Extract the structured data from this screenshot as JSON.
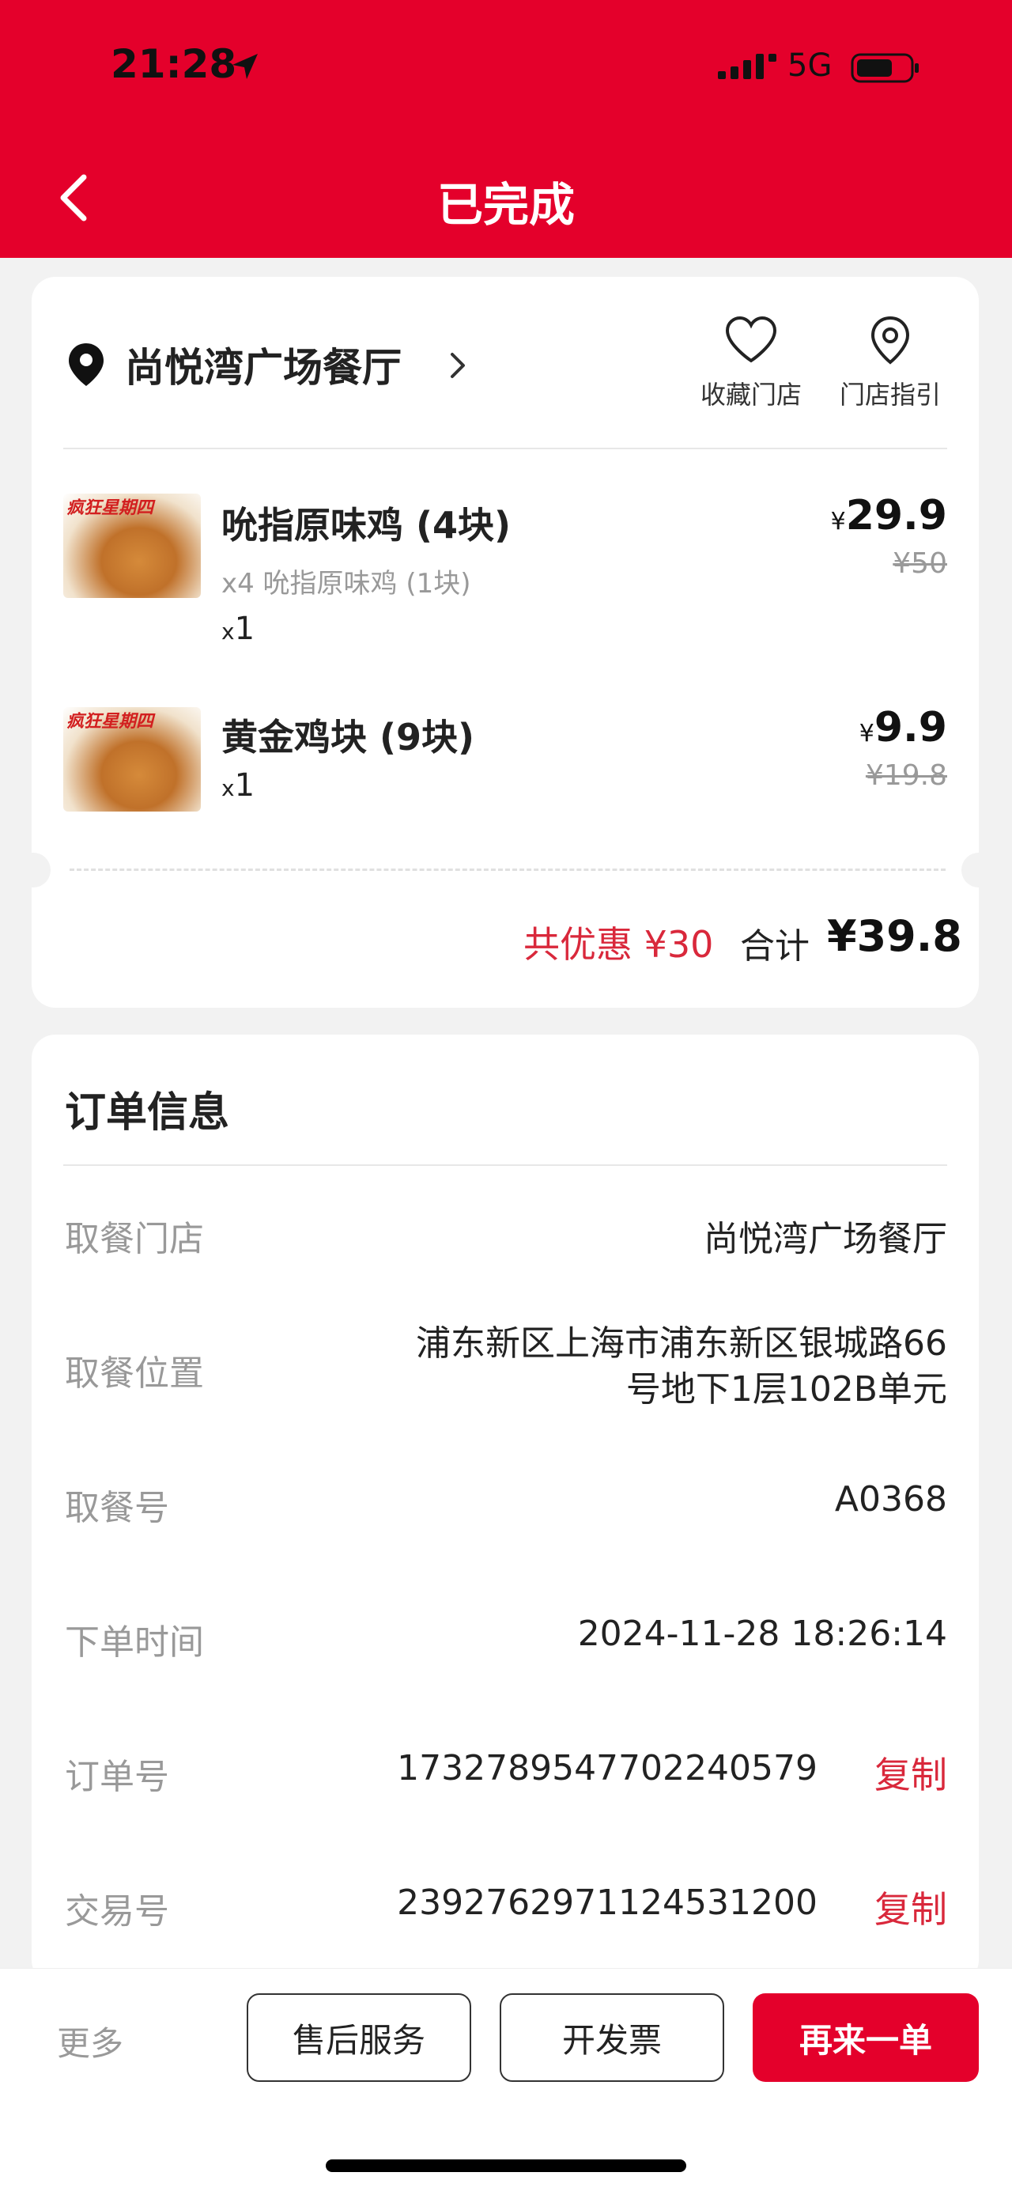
{
  "status_bar": {
    "time": "21:28",
    "network": "5G",
    "icons": [
      "location-arrow-icon",
      "signal-icon",
      "battery-icon"
    ]
  },
  "header": {
    "title": "已完成",
    "back_icon": "chevron-left-icon",
    "color": "#e4002b"
  },
  "store": {
    "name": "尚悦湾广场餐厅",
    "favorite_label": "收藏门店",
    "guide_label": "门店指引"
  },
  "items": [
    {
      "banner": "疯狂星期四",
      "name": "吮指原味鸡 (4块)",
      "sub": "x4 吮指原味鸡 (1块)",
      "qty_prefix": "x",
      "qty": "1",
      "currency": "¥",
      "price": "29.9",
      "original_price": "¥50"
    },
    {
      "banner": "疯狂星期四",
      "name": "黄金鸡块 (9块)",
      "sub": "",
      "qty_prefix": "x",
      "qty": "1",
      "currency": "¥",
      "price": "9.9",
      "original_price": "¥19.8"
    }
  ],
  "summary": {
    "discount": "共优惠 ¥30",
    "total_label": "合计",
    "total": "¥39.8"
  },
  "order_info": {
    "title": "订单信息",
    "copy_label": "复制",
    "rows": [
      {
        "label": "取餐门店",
        "value": "尚悦湾广场餐厅"
      },
      {
        "label": "取餐位置",
        "value_line1": "浦东新区上海市浦东新区银城路66",
        "value_line2": "号地下1层102B单元"
      },
      {
        "label": "取餐号",
        "value": "A0368"
      },
      {
        "label": "下单时间",
        "value": "2024-11-28 18:26:14"
      },
      {
        "label": "订单号",
        "value": "1732789547702240579"
      },
      {
        "label": "交易号",
        "value": "2392762971124531200"
      }
    ]
  },
  "bottom_bar": {
    "more": "更多",
    "after_sales": "售后服务",
    "invoice": "开发票",
    "reorder": "再来一单"
  },
  "colors": {
    "brand_red": "#e4002b",
    "discount_red": "#d9283b"
  }
}
